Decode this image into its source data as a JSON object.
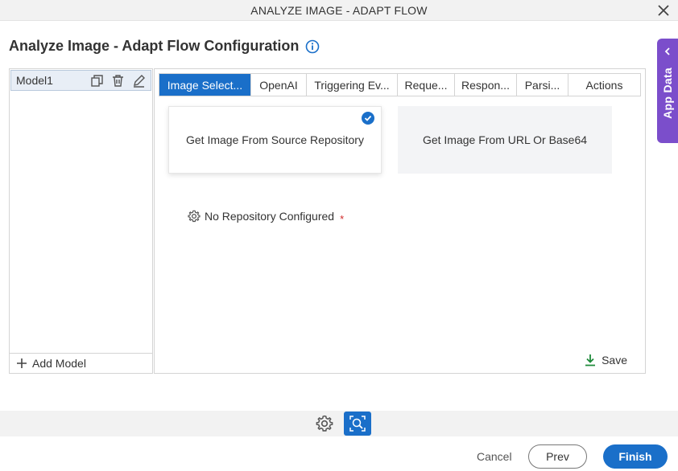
{
  "window": {
    "title": "ANALYZE IMAGE - ADAPT FLOW",
    "close_icon": "close-icon"
  },
  "page": {
    "title": "Analyze Image - Adapt Flow Configuration",
    "info_icon": "info-icon"
  },
  "app_data": {
    "label": "App Data",
    "color": "#7b4ecb"
  },
  "models": {
    "items": [
      {
        "label": "Model1"
      }
    ],
    "add_label": "Add Model"
  },
  "tabs": [
    {
      "label": "Image Select...",
      "active": true
    },
    {
      "label": "OpenAI"
    },
    {
      "label": "Triggering Ev..."
    },
    {
      "label": "Reque..."
    },
    {
      "label": "Respon..."
    },
    {
      "label": "Parsi..."
    },
    {
      "label": "Actions"
    }
  ],
  "image_source": {
    "options": [
      {
        "label": "Get Image From Source Repository",
        "selected": true
      },
      {
        "label": "Get Image From URL Or Base64",
        "selected": false
      }
    ]
  },
  "repository": {
    "label": "No Repository Configured",
    "required_mark": "*"
  },
  "save_label": "Save",
  "footer": {
    "cancel": "Cancel",
    "prev": "Prev",
    "finish": "Finish"
  },
  "colors": {
    "accent": "#1a6fc9",
    "required": "#d12a2a",
    "save_icon": "#1e8a3a"
  }
}
